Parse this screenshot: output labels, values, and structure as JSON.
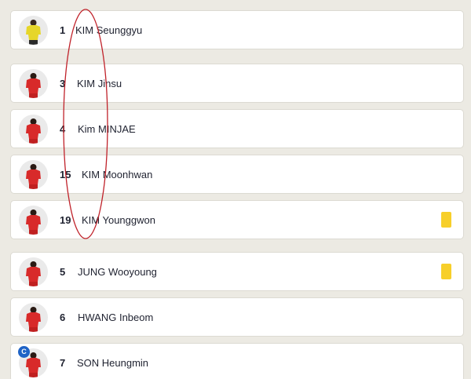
{
  "colors": {
    "background": "#eceae3",
    "card": "#ffffff",
    "keeper_kit": "#e6d62a",
    "outfield_kit": "#d82a2a",
    "yellow_card": "#f7cf2a",
    "captain_badge": "#1f63c6",
    "annotation": "#c0222a"
  },
  "players": [
    {
      "number": "1",
      "name": "KIM Seunggyu",
      "kit": "keeper",
      "yellow_card": false,
      "captain": false
    },
    {
      "number": "3",
      "name": "KIM Jinsu",
      "kit": "outfield",
      "yellow_card": false,
      "captain": false
    },
    {
      "number": "4",
      "name": "Kim MINJAE",
      "kit": "outfield",
      "yellow_card": false,
      "captain": false
    },
    {
      "number": "15",
      "name": "KIM Moonhwan",
      "kit": "outfield",
      "yellow_card": false,
      "captain": false
    },
    {
      "number": "19",
      "name": "KIM Younggwon",
      "kit": "outfield",
      "yellow_card": true,
      "captain": false
    },
    {
      "number": "5",
      "name": "JUNG Wooyoung",
      "kit": "outfield",
      "yellow_card": true,
      "captain": false
    },
    {
      "number": "6",
      "name": "HWANG Inbeom",
      "kit": "outfield",
      "yellow_card": false,
      "captain": false
    },
    {
      "number": "7",
      "name": "SON Heungmin",
      "kit": "outfield",
      "yellow_card": false,
      "captain": true,
      "captain_label": "C"
    }
  ]
}
